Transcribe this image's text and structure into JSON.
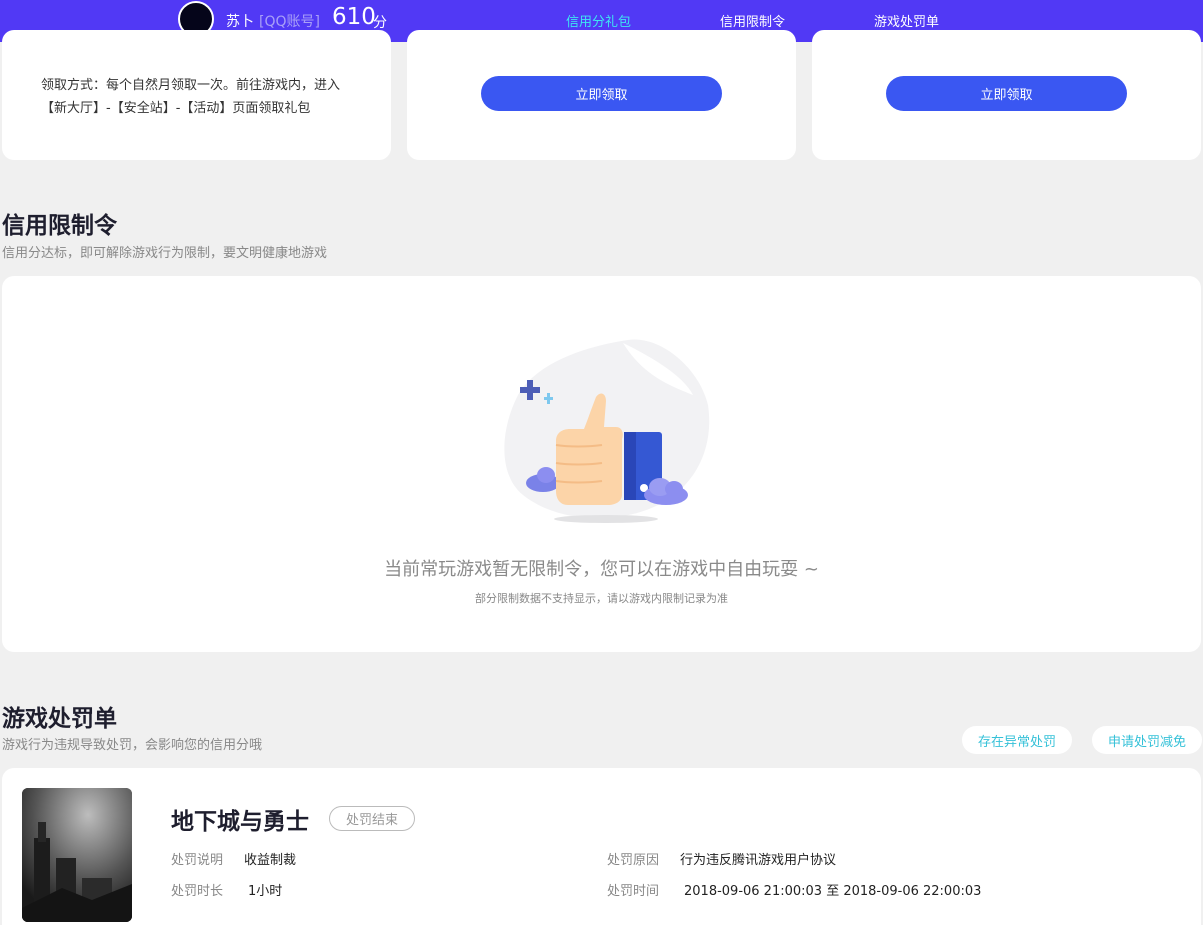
{
  "header": {
    "username": "苏卜",
    "account_type": "[QQ账号]",
    "score": "610",
    "score_unit": "分",
    "tabs": [
      {
        "label": "信用分礼包",
        "active": true
      },
      {
        "label": "信用限制令",
        "active": false
      },
      {
        "label": "游戏处罚单",
        "active": false
      }
    ]
  },
  "gift_cards": {
    "claim_method": "领取方式：每个自然月领取一次。前往游戏内，进入【新大厅】-【安全站】-【活动】页面领取礼包",
    "claim_button": "立即领取"
  },
  "restriction": {
    "title": "信用限制令",
    "subtitle": "信用分达标，即可解除游戏行为限制，要文明健康地游戏",
    "empty_message": "当前常玩游戏暂无限制令，您可以在游戏中自由玩耍 ~",
    "empty_note": "部分限制数据不支持显示，请以游戏内限制记录为准"
  },
  "penalty": {
    "title": "游戏处罚单",
    "subtitle": "游戏行为违规导致处罚，会影响您的信用分哦",
    "buttons": {
      "abnormal": "存在异常处罚",
      "reduce": "申请处罚减免"
    },
    "record": {
      "game": "地下城与勇士",
      "status": "处罚结束",
      "desc_label": "处罚说明",
      "desc_value": "收益制裁",
      "duration_label": "处罚时长",
      "duration_value": "1小时",
      "reason_label": "处罚原因",
      "reason_value": "行为违反腾讯游戏用户协议",
      "time_label": "处罚时间",
      "time_value": "2018-09-06 21:00:03 至 2018-09-06 22:00:03"
    }
  },
  "colors": {
    "topbar": "#5139f5",
    "active_tab": "#3ee6f2",
    "button": "#3a57f2",
    "link": "#35c1d8"
  }
}
